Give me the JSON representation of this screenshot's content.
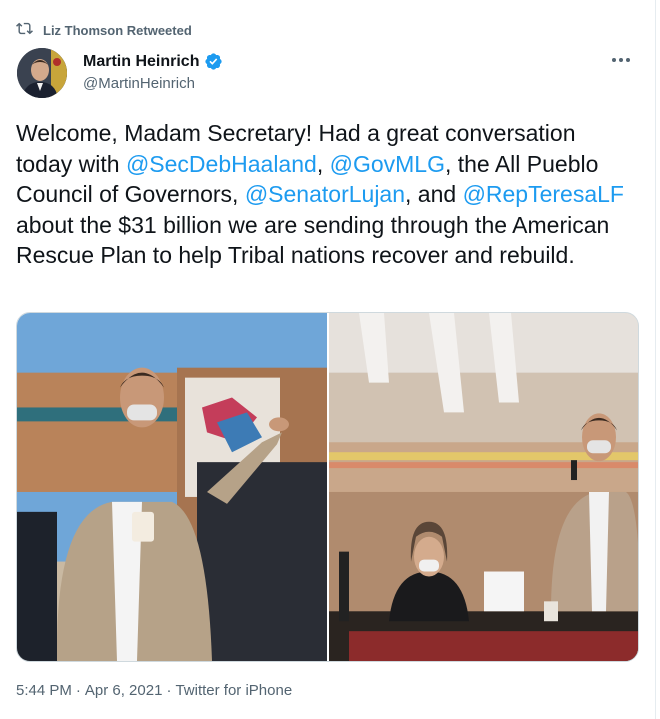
{
  "retweet": {
    "label": "Liz Thomson Retweeted"
  },
  "author": {
    "name": "Martin Heinrich",
    "handle": "@MartinHeinrich"
  },
  "tweet": {
    "t1": "Welcome, Madam Secretary! Had a great conversation today with ",
    "m1": "@SecDebHaaland",
    "t2": ", ",
    "m2": "@GovMLG",
    "t3": ", the All Pueblo Council of Governors, ",
    "m3": "@SenatorLujan",
    "t4": ", and ",
    "m4": "@RepTeresaLF",
    "t5": " about the $31 billion we are sending through the American Rescue Plan to help Tribal nations recover and rebuild."
  },
  "meta": {
    "time": "5:44 PM",
    "sep1": "·",
    "date": "Apr 6, 2021",
    "sep2": "·",
    "source": "Twitter for iPhone"
  },
  "icons": {
    "retweet": "retweet-icon",
    "verified": "verified-badge-icon",
    "more": "more-options-icon"
  },
  "colors": {
    "link": "#1d9bf0",
    "secondary": "#536471",
    "text": "#0f1419"
  }
}
